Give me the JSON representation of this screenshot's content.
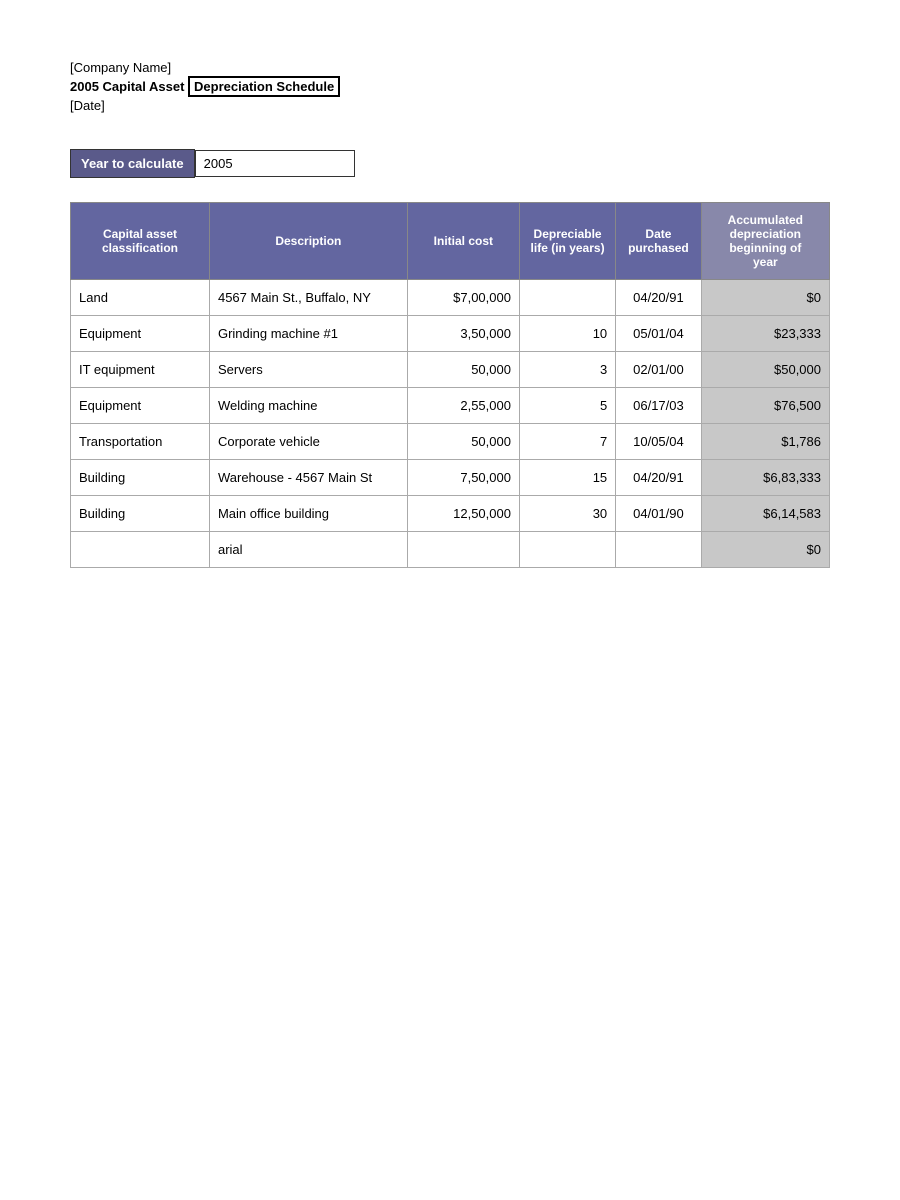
{
  "header": {
    "company_name": "[Company Name]",
    "title_part1": "2005 Capital Asset",
    "title_part2": "Depreciation Schedule",
    "date": "[Date]"
  },
  "year_section": {
    "label": "Year to calculate",
    "value": "2005"
  },
  "table": {
    "columns": [
      {
        "key": "classification",
        "label": "Capital asset classification"
      },
      {
        "key": "description",
        "label": "Description"
      },
      {
        "key": "initial_cost",
        "label": "Initial cost"
      },
      {
        "key": "life",
        "label": "Depreciable life (in years)"
      },
      {
        "key": "date_purchased",
        "label": "Date purchased"
      },
      {
        "key": "accum_depreciation",
        "label": "Accumulated depreciation beginning of year"
      }
    ],
    "rows": [
      {
        "classification": "Land",
        "description": "4567 Main St., Buffalo, NY",
        "initial_cost": "$7,00,000",
        "life": "",
        "date_purchased": "04/20/91",
        "accum_depreciation": "$0"
      },
      {
        "classification": "Equipment",
        "description": "Grinding machine #1",
        "initial_cost": "3,50,000",
        "life": "10",
        "date_purchased": "05/01/04",
        "accum_depreciation": "$23,333"
      },
      {
        "classification": "IT equipment",
        "description": "Servers",
        "initial_cost": "50,000",
        "life": "3",
        "date_purchased": "02/01/00",
        "accum_depreciation": "$50,000"
      },
      {
        "classification": "Equipment",
        "description": "Welding machine",
        "initial_cost": "2,55,000",
        "life": "5",
        "date_purchased": "06/17/03",
        "accum_depreciation": "$76,500"
      },
      {
        "classification": "Transportation",
        "description": "Corporate vehicle",
        "initial_cost": "50,000",
        "life": "7",
        "date_purchased": "10/05/04",
        "accum_depreciation": "$1,786"
      },
      {
        "classification": "Building",
        "description": "Warehouse - 4567 Main St",
        "initial_cost": "7,50,000",
        "life": "15",
        "date_purchased": "04/20/91",
        "accum_depreciation": "$6,83,333"
      },
      {
        "classification": "Building",
        "description": "Main office building",
        "initial_cost": "12,50,000",
        "life": "30",
        "date_purchased": "04/01/90",
        "accum_depreciation": "$6,14,583"
      },
      {
        "classification": "",
        "description": "arial",
        "initial_cost": "",
        "life": "",
        "date_purchased": "",
        "accum_depreciation": "$0"
      }
    ]
  }
}
